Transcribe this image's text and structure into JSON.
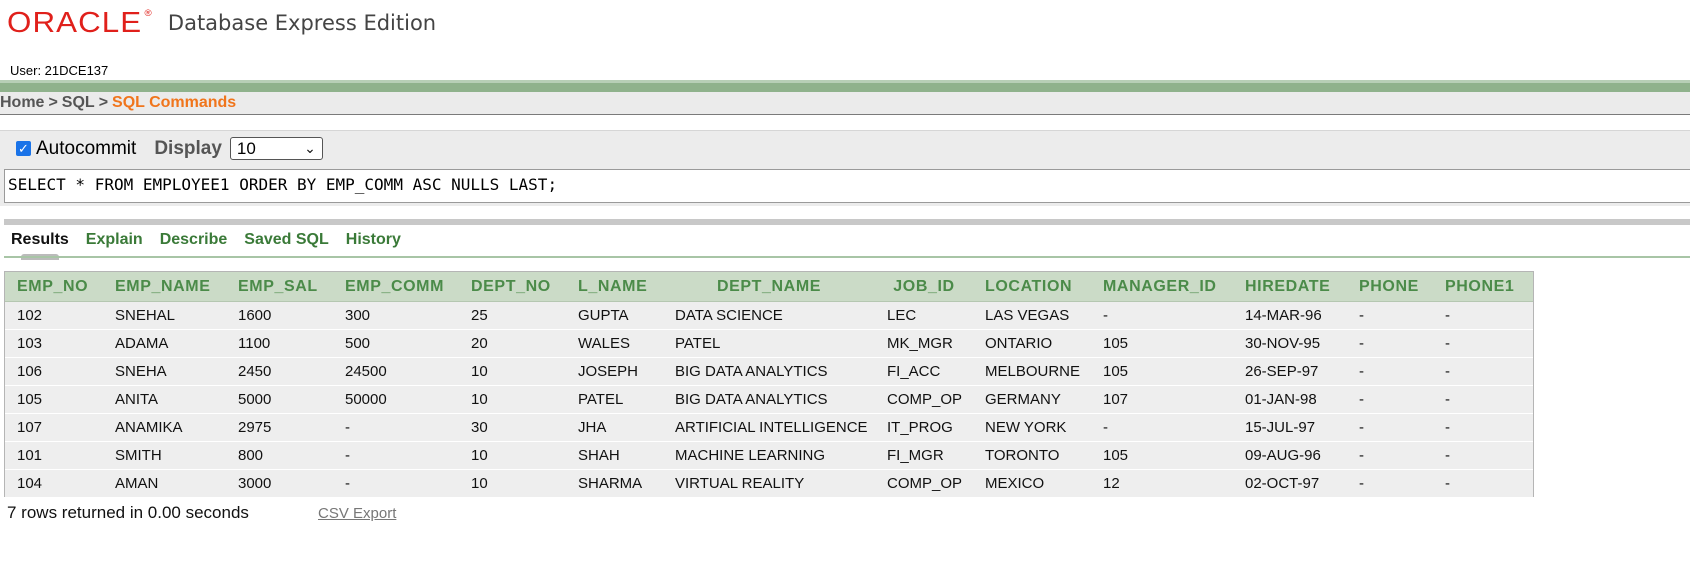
{
  "header": {
    "logo": "ORACLE",
    "logo_mark": "®",
    "product": "Database Express Edition",
    "user_line": "User: 21DCE137"
  },
  "breadcrumb": {
    "home": "Home",
    "sql": "SQL",
    "current": "SQL Commands",
    "sep": ">"
  },
  "controls": {
    "autocommit_label": "Autocommit",
    "autocommit_checked": true,
    "display_label": "Display",
    "display_value": "10"
  },
  "editor": {
    "sql": "SELECT * FROM EMPLOYEE1 ORDER BY EMP_COMM ASC NULLS LAST;"
  },
  "tabs": [
    "Results",
    "Explain",
    "Describe",
    "Saved SQL",
    "History"
  ],
  "results": {
    "columns": [
      "EMP_NO",
      "EMP_NAME",
      "EMP_SAL",
      "EMP_COMM",
      "DEPT_NO",
      "L_NAME",
      "DEPT_NAME",
      "JOB_ID",
      "LOCATION",
      "MANAGER_ID",
      "HIREDATE",
      "PHONE",
      "PHONE1"
    ],
    "rows": [
      [
        "102",
        "SNEHAL",
        "1600",
        "300",
        "25",
        "GUPTA",
        "DATA SCIENCE",
        "LEC",
        "LAS VEGAS",
        "-",
        "14-MAR-96",
        "-",
        "-"
      ],
      [
        "103",
        "ADAMA",
        "1100",
        "500",
        "20",
        "WALES",
        "PATEL",
        "MK_MGR",
        "ONTARIO",
        "105",
        "30-NOV-95",
        "-",
        "-"
      ],
      [
        "106",
        "SNEHA",
        "2450",
        "24500",
        "10",
        "JOSEPH",
        "BIG DATA ANALYTICS",
        "FI_ACC",
        "MELBOURNE",
        "105",
        "26-SEP-97",
        "-",
        "-"
      ],
      [
        "105",
        "ANITA",
        "5000",
        "50000",
        "10",
        "PATEL",
        "BIG DATA ANALYTICS",
        "COMP_OP",
        "GERMANY",
        "107",
        "01-JAN-98",
        "-",
        "-"
      ],
      [
        "107",
        "ANAMIKA",
        "2975",
        "-",
        "30",
        "JHA",
        "ARTIFICIAL INTELLIGENCE",
        "IT_PROG",
        "NEW YORK",
        "-",
        "15-JUL-97",
        "-",
        "-"
      ],
      [
        "101",
        "SMITH",
        "800",
        "-",
        "10",
        "SHAH",
        "MACHINE LEARNING",
        "FI_MGR",
        "TORONTO",
        "105",
        "09-AUG-96",
        "-",
        "-"
      ],
      [
        "104",
        "AMAN",
        "3000",
        "-",
        "10",
        "SHARMA",
        "VIRTUAL REALITY",
        "COMP_OP",
        "MEXICO",
        "12",
        "02-OCT-97",
        "-",
        "-"
      ]
    ],
    "summary": "7 rows returned in 0.00 seconds",
    "csv_export": "CSV Export"
  }
}
